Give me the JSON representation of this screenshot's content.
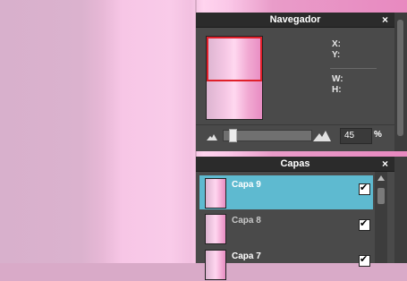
{
  "navigator": {
    "title": "Navegador",
    "close": "×",
    "x_label": "X:",
    "y_label": "Y:",
    "w_label": "W:",
    "h_label": "H:",
    "zoom_value": "45",
    "zoom_unit": "%",
    "zoom_slider_level": 0.08
  },
  "layers": {
    "title": "Capas",
    "close": "×",
    "items": [
      {
        "name": "Capa 9",
        "visible": true,
        "selected": true
      },
      {
        "name": "Capa 8",
        "visible": true,
        "selected": false
      },
      {
        "name": "Capa 7",
        "visible": true,
        "selected": false
      }
    ]
  },
  "colors": {
    "selection": "#5ebad0",
    "viewport_rect": "#e0202a",
    "panel_bg": "#4a4a4a",
    "title_bg": "#2b2b2b"
  },
  "icons": [
    "close-icon",
    "mountain-small-icon",
    "mountain-large-icon",
    "checkbox-icon",
    "scroll-up-icon"
  ]
}
